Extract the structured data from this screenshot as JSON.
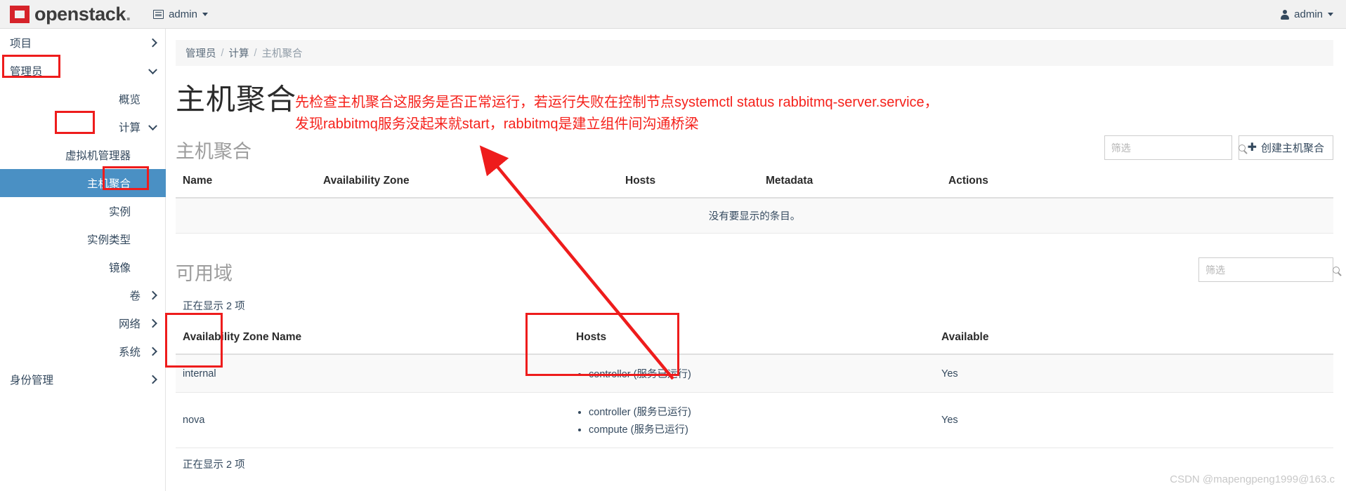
{
  "navbar": {
    "brand_name": "openstack",
    "brand_dot": ".",
    "context_label": "admin",
    "user_label": "admin"
  },
  "sidebar": {
    "items": [
      {
        "label": "项目",
        "level": 0,
        "state": "collapsed",
        "active": false
      },
      {
        "label": "管理员",
        "level": 0,
        "state": "expanded",
        "active": false
      },
      {
        "label": "概览",
        "level": 1,
        "state": "none",
        "active": false
      },
      {
        "label": "计算",
        "level": 1,
        "state": "expanded",
        "active": false
      },
      {
        "label": "虚拟机管理器",
        "level": 2,
        "state": "none",
        "active": false
      },
      {
        "label": "主机聚合",
        "level": 2,
        "state": "none",
        "active": true
      },
      {
        "label": "实例",
        "level": 2,
        "state": "none",
        "active": false
      },
      {
        "label": "实例类型",
        "level": 2,
        "state": "none",
        "active": false
      },
      {
        "label": "镜像",
        "level": 2,
        "state": "none",
        "active": false
      },
      {
        "label": "卷",
        "level": 1,
        "state": "collapsed",
        "active": false
      },
      {
        "label": "网络",
        "level": 1,
        "state": "collapsed",
        "active": false
      },
      {
        "label": "系统",
        "level": 1,
        "state": "collapsed",
        "active": false
      },
      {
        "label": "身份管理",
        "level": 0,
        "state": "collapsed",
        "active": false
      }
    ]
  },
  "breadcrumb": {
    "root": "管理员",
    "mid": "计算",
    "current": "主机聚合",
    "separator": "/"
  },
  "page": {
    "title": "主机聚合"
  },
  "annotation": {
    "line1": "先检查主机聚合这服务是否正常运行，若运行失败在控制节点systemctl status rabbitmq-server.service，",
    "line2": "发现rabbitmq服务没起来就start，rabbitmq是建立组件间沟通桥梁",
    "color": "#f5211b"
  },
  "aggregates_section": {
    "title": "主机聚合",
    "filter_placeholder": "筛选",
    "create_button": "创建主机聚合",
    "create_icon": "plus-icon",
    "search_icon": "search-icon",
    "columns": [
      "Name",
      "Availability Zone",
      "Hosts",
      "Metadata",
      "Actions"
    ],
    "empty_message": "没有要显示的条目。",
    "rows": []
  },
  "zones_section": {
    "title": "可用域",
    "filter_placeholder": "筛选",
    "search_icon": "search-icon",
    "count_top": "正在显示 2 项",
    "count_bottom": "正在显示 2 项",
    "columns": [
      "Availability Zone Name",
      "Hosts",
      "Available"
    ],
    "rows": [
      {
        "name": "internal",
        "hosts": [
          "controller (服务已运行)"
        ],
        "available": "Yes"
      },
      {
        "name": "nova",
        "hosts": [
          "controller (服务已运行)",
          "compute (服务已运行)"
        ],
        "available": "Yes"
      }
    ]
  },
  "watermark": {
    "text": "CSDN @mapengpeng1999@163.c"
  },
  "colors": {
    "brand_red": "#d6232a",
    "active_nav": "#4a90c4",
    "annotation_red": "#f5211b",
    "highlight_box": "#ee1c1c"
  }
}
